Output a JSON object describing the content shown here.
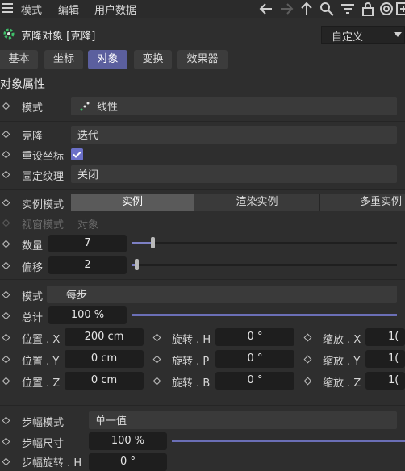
{
  "menubar": {
    "items": [
      "模式",
      "编辑",
      "用户数据"
    ]
  },
  "header": {
    "title": "克隆对象 [克隆]",
    "preset": "自定义"
  },
  "tabs": [
    {
      "label": "基本",
      "active": false
    },
    {
      "label": "坐标",
      "active": false
    },
    {
      "label": "对象",
      "active": true
    },
    {
      "label": "变换",
      "active": false
    },
    {
      "label": "效果器",
      "active": false
    }
  ],
  "section_title": "对象属性",
  "props": {
    "mode": {
      "label": "模式",
      "value": "线性"
    },
    "clone": {
      "label": "克隆",
      "value": "迭代"
    },
    "reset_coords": {
      "label": "重设坐标",
      "checked": true
    },
    "fix_texture": {
      "label": "固定纹理",
      "value": "关闭"
    },
    "instance_mode": {
      "label": "实例模式",
      "options": [
        "实例",
        "渲染实例",
        "多重实例"
      ],
      "selected": "实例"
    },
    "viewport_mode": {
      "label": "视窗模式",
      "value": "对象"
    },
    "count": {
      "label": "数量",
      "value": "7",
      "slider_fraction": 0.03
    },
    "offset": {
      "label": "偏移",
      "value": "2",
      "slider_fraction": 0.0
    },
    "mode2": {
      "label": "模式",
      "value": "每步"
    },
    "total": {
      "label": "总计",
      "value": "100 %",
      "slider_fraction": 1.0
    },
    "pos_x": {
      "label": "位置 . X",
      "value": "200 cm"
    },
    "pos_y": {
      "label": "位置 . Y",
      "value": "0 cm"
    },
    "pos_z": {
      "label": "位置 . Z",
      "value": "0 cm"
    },
    "rot_h": {
      "label": "旋转 . H",
      "value": "0 °"
    },
    "rot_p": {
      "label": "旋转 . P",
      "value": "0 °"
    },
    "rot_b": {
      "label": "旋转 . B",
      "value": "0 °"
    },
    "scale_x": {
      "label": "缩放 . X",
      "value": "1("
    },
    "scale_y": {
      "label": "缩放 . Y",
      "value": "1("
    },
    "scale_z": {
      "label": "缩放 . Z",
      "value": "1("
    },
    "step_mode": {
      "label": "步幅模式",
      "value": "单一值"
    },
    "step_size": {
      "label": "步幅尺寸",
      "value": "100 %",
      "slider_fraction": 1.0
    },
    "step_rot": {
      "label": "步幅旋转 . H",
      "value": "0 °"
    }
  },
  "colors": {
    "accent": "#5b5f9e",
    "slider": "#7d80c4",
    "background": "#2e2e2e"
  },
  "icons": [
    "menu-icon",
    "arrow-left-icon",
    "arrow-right-icon",
    "arrow-up-icon",
    "search-icon",
    "filter-icon",
    "lock-icon",
    "target-icon",
    "add-panel-icon",
    "cloner-icon",
    "linear-mode-icon",
    "checkmark-icon"
  ]
}
